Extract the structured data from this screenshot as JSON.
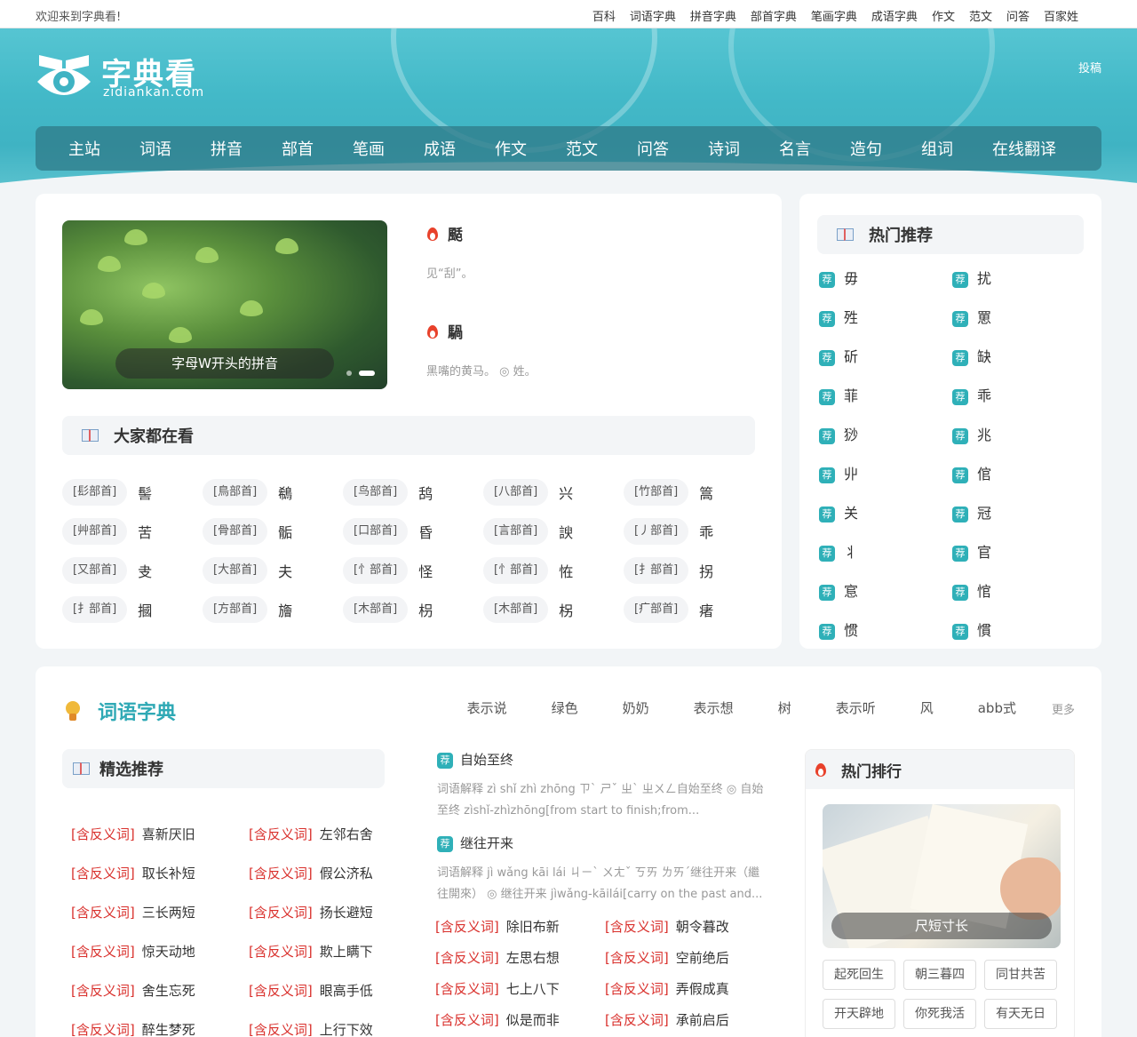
{
  "topbar": {
    "welcome": "欢迎来到字典看!",
    "links": [
      "百科",
      "词语字典",
      "拼音字典",
      "部首字典",
      "笔画字典",
      "成语字典",
      "作文",
      "范文",
      "问答",
      "百家姓"
    ]
  },
  "header": {
    "logo_title": "字典看",
    "logo_sub": "zidiankan.com",
    "tougao": "投稿",
    "nav": [
      "主站",
      "词语",
      "拼音",
      "部首",
      "笔画",
      "成语",
      "作文",
      "范文",
      "问答",
      "诗词",
      "名言",
      "造句",
      "组词",
      "在线翻译"
    ]
  },
  "colors": {
    "accent": "#2fa9b5",
    "nav_bg": "#2f7c8a",
    "red": "#d9302c"
  },
  "slider": {
    "caption": "字母W开头的拼音"
  },
  "featured": [
    {
      "char": "颳",
      "desc": "见“刮”。"
    },
    {
      "char": "騧",
      "desc": "黑嘴的黄马。 ◎ 姓。"
    }
  ],
  "popular": {
    "title": "大家都在看",
    "items": [
      {
        "tag": "[髟部首]",
        "char": "髻"
      },
      {
        "tag": "[鳥部首]",
        "char": "鵗"
      },
      {
        "tag": "[鸟部首]",
        "char": "鸹"
      },
      {
        "tag": "[八部首]",
        "char": "兴"
      },
      {
        "tag": "[竹部首]",
        "char": "篙"
      },
      {
        "tag": "[艸部首]",
        "char": "苦"
      },
      {
        "tag": "[骨部首]",
        "char": "骺"
      },
      {
        "tag": "[口部首]",
        "char": "昏"
      },
      {
        "tag": "[言部首]",
        "char": "諛"
      },
      {
        "tag": "[丿部首]",
        "char": "乖"
      },
      {
        "tag": "[又部首]",
        "char": "叏"
      },
      {
        "tag": "[大部首]",
        "char": "夫"
      },
      {
        "tag": "[忄部首]",
        "char": "怪"
      },
      {
        "tag": "[忄部首]",
        "char": "恠"
      },
      {
        "tag": "[扌部首]",
        "char": "拐"
      },
      {
        "tag": "[扌部首]",
        "char": "摑"
      },
      {
        "tag": "[方部首]",
        "char": "旝"
      },
      {
        "tag": "[木部首]",
        "char": "枴"
      },
      {
        "tag": "[木部首]",
        "char": "柺"
      },
      {
        "tag": "[疒部首]",
        "char": "瘏"
      }
    ]
  },
  "hot_recommend": {
    "title": "热门推荐",
    "badge": "荐",
    "items": [
      "毋",
      "扰",
      "殅",
      "罳",
      "斫",
      "缺",
      "菲",
      "乖",
      "猀",
      "兆",
      "丱",
      "倌",
      "关",
      "冠",
      "丬",
      "官",
      "悹",
      "悺",
      "惯",
      "慣"
    ]
  },
  "ciyu": {
    "title": "词语字典",
    "tabs": [
      "表示说",
      "绿色",
      "奶奶",
      "表示想",
      "树",
      "表示听",
      "风",
      "abb式"
    ],
    "more": "更多"
  },
  "selected": {
    "title": "精选推荐",
    "tag": "[含反义词]",
    "words": [
      "喜新厌旧",
      "左邻右舍",
      "取长补短",
      "假公济私",
      "三长两短",
      "扬长避短",
      "惊天动地",
      "欺上瞒下",
      "舍生忘死",
      "眼高手低",
      "醉生梦死",
      "上行下效"
    ]
  },
  "rec_words": [
    {
      "word": "自始至终",
      "exp": "词语解释 zì shǐ zhì zhōng ㄗˋ ㄕˇ ㄓˋ ㄓㄨㄥ自始至终 ◎ 自始至终 zìshǐ-zhìzhōng[from start to finish;from..."
    },
    {
      "word": "继往开来",
      "exp": "词语解释 jì wǎng kāi lái ㄐㄧˋ ㄨㄤˇ ㄎㄞ ㄌㄞˊ继往开来（繼往開來） ◎ 继往开来 jìwǎng-kāilái[carry on the past and..."
    }
  ],
  "mid_anto": {
    "tag": "[含反义词]",
    "words": [
      "除旧布新",
      "朝令暮改",
      "左思右想",
      "空前绝后",
      "七上八下",
      "弄假成真",
      "似是而非",
      "承前启后"
    ]
  },
  "hot_rank": {
    "title": "热门排行",
    "caption": "尺短寸长",
    "chips": [
      "起死回生",
      "朝三暮四",
      "同甘共苦",
      "开天辟地",
      "你死我活",
      "有天无日"
    ]
  }
}
